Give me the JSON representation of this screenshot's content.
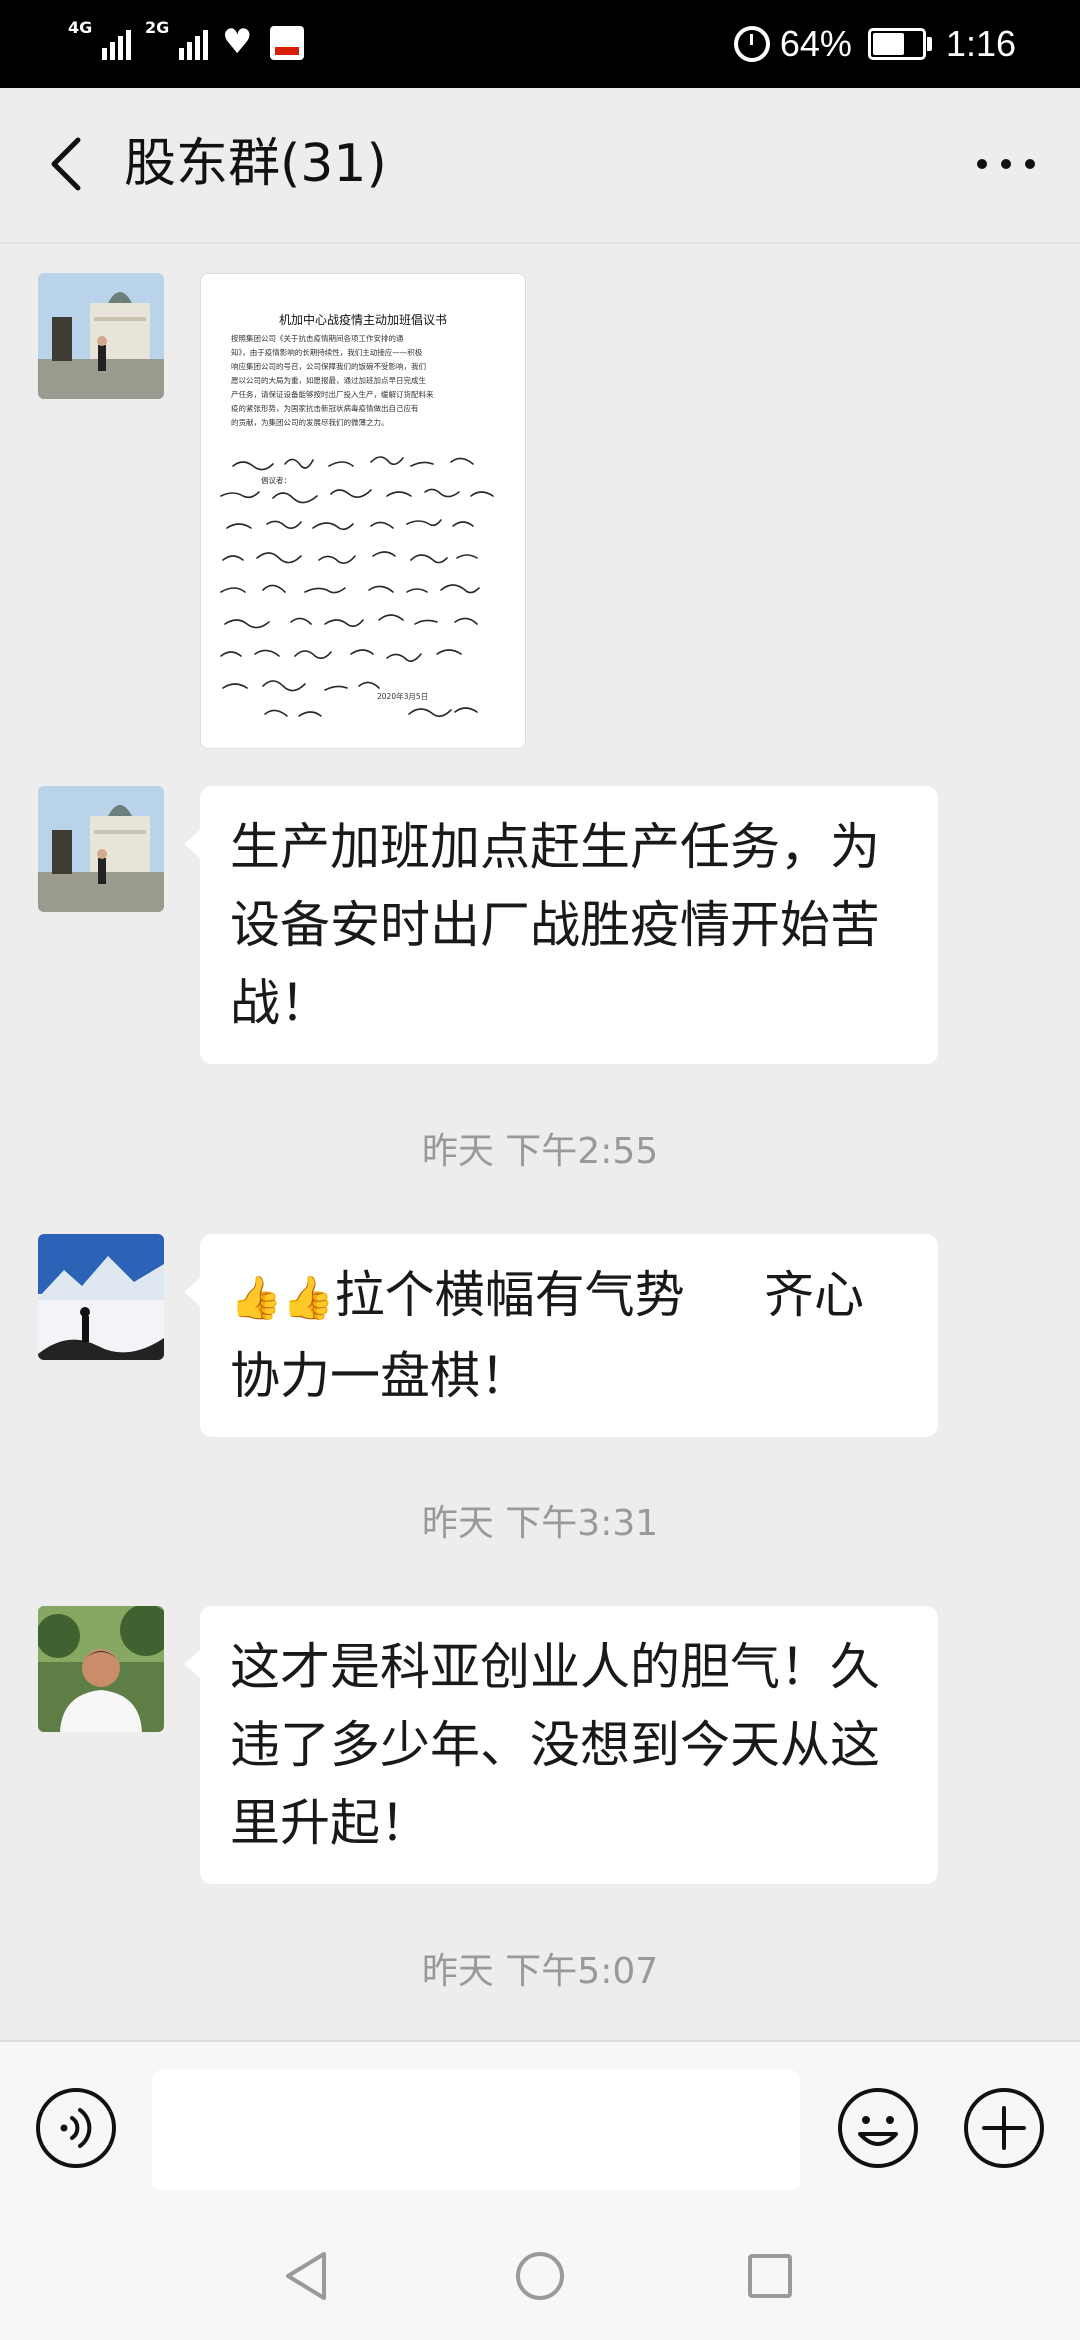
{
  "status_bar": {
    "network_1": "4G",
    "network_2": "2G",
    "battery_text": "64%",
    "battery_level": 0.64,
    "time": "1:16"
  },
  "header": {
    "title": "股东群(31)"
  },
  "chat": {
    "messages": [
      {
        "type": "image",
        "avatar_icon": "avatar-monument-photo",
        "document_title": "机加中心战疫情主动加班倡议书",
        "document_lines": [
          "按照集团公司《关于抗击疫情期间各项工作安排的通",
          "知》，由于疫情影响的长期持续性，我们主动接应——积极",
          "响应集团公司的号召，公司保障我们的饭碗不受影响，我们",
          "愿以公司的大局为重，如愿报最，通过加班加点早日完成生",
          "产任务，请保证设备能够按时出厂投入生产，缓解订货配料来",
          "疫的紧张形势，为国家抗击新冠状病毒疫情做出自己应有",
          "的贡献，为集团公司的发展尽我们的微薄之力。"
        ],
        "signers_label": "倡议者：",
        "document_date": "2020年3月5日"
      },
      {
        "type": "text",
        "avatar_icon": "avatar-monument-photo",
        "text": "生产加班加点赶生产任务，为设备安时出厂战胜疫情开始苦战！"
      },
      {
        "type": "timestamp",
        "text": "昨天 下午2:55"
      },
      {
        "type": "text",
        "avatar_icon": "avatar-mountain-photo",
        "emoji": "👍👍",
        "text": "拉个横幅有气势     齐心协力一盘棋！"
      },
      {
        "type": "timestamp",
        "text": "昨天 下午3:31"
      },
      {
        "type": "text",
        "avatar_icon": "avatar-person-photo",
        "text": "这才是科亚创业人的胆气！久违了多少年、没想到今天从这里升起！"
      },
      {
        "type": "timestamp",
        "text": "昨天 下午5:07"
      }
    ]
  },
  "input_bar": {
    "value": "",
    "voice_icon": "voice-icon",
    "emoji_icon": "emoji-icon",
    "plus_icon": "plus-icon"
  },
  "nav_bar": {
    "back_icon": "nav-back-icon",
    "home_icon": "nav-home-icon",
    "recent_icon": "nav-recent-icon"
  },
  "colors": {
    "background": "#ededed",
    "bubble": "#ffffff",
    "timestamp": "#999999",
    "status_bar": "#000000"
  }
}
